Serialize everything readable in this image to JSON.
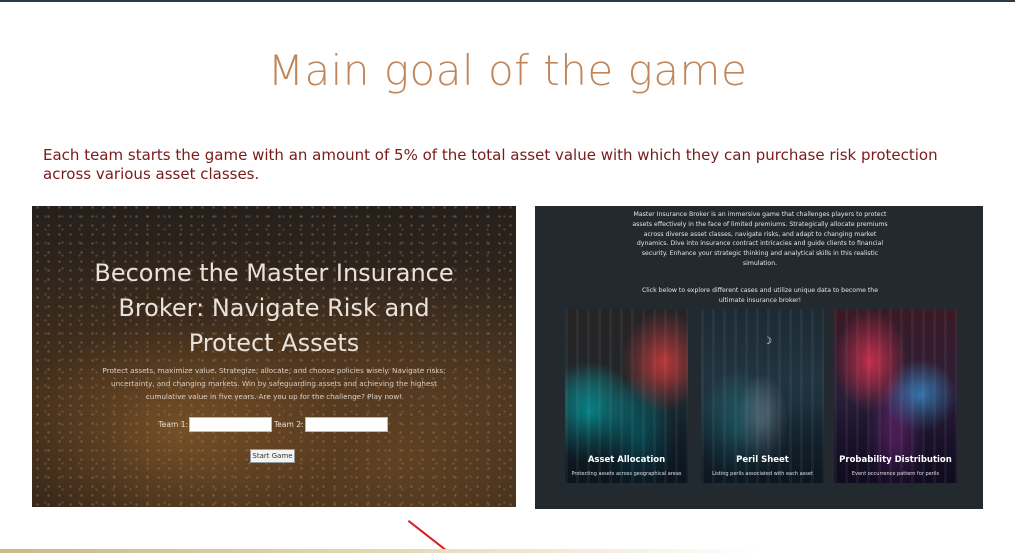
{
  "page": {
    "title": "Main goal of the game",
    "intro": "Each team starts the game with an amount of 5% of the total asset value with which they can purchase risk protection across various asset classes."
  },
  "hero": {
    "title": "Become the Master Insurance Broker: Navigate Risk and Protect Assets",
    "description": "Protect assets, maximize value. Strategize, allocate, and choose policies wisely. Navigate risks, uncertainty, and changing markets. Win by safeguarding assets and achieving the highest cumulative value in five years. Are you up for the challenge? Play now!",
    "team1_label": "Team 1:",
    "team1_value": "",
    "team2_label": "Team 2:",
    "team2_value": "",
    "start_label": "Start Game"
  },
  "info": {
    "text": "Master Insurance Broker is an immersive game that challenges players to protect assets effectively in the face of limited premiums. Strategically allocate premiums across diverse asset classes, navigate risks, and adapt to changing market dynamics. Dive into insurance contract intricacies and guide clients to financial security. Enhance your strategic thinking and analytical skills in this realistic simulation.",
    "cta": "Click below to explore different cases and utilize unique data to become the ultimate insurance broker!",
    "cards": [
      {
        "label": "Asset Allocation",
        "sub": "Protecting assets across geographical areas"
      },
      {
        "label": "Peril Sheet",
        "sub": "Listing perils associated with each asset"
      },
      {
        "label": "Probability Distribution",
        "sub": "Event occurrence pattern for perils"
      }
    ]
  }
}
